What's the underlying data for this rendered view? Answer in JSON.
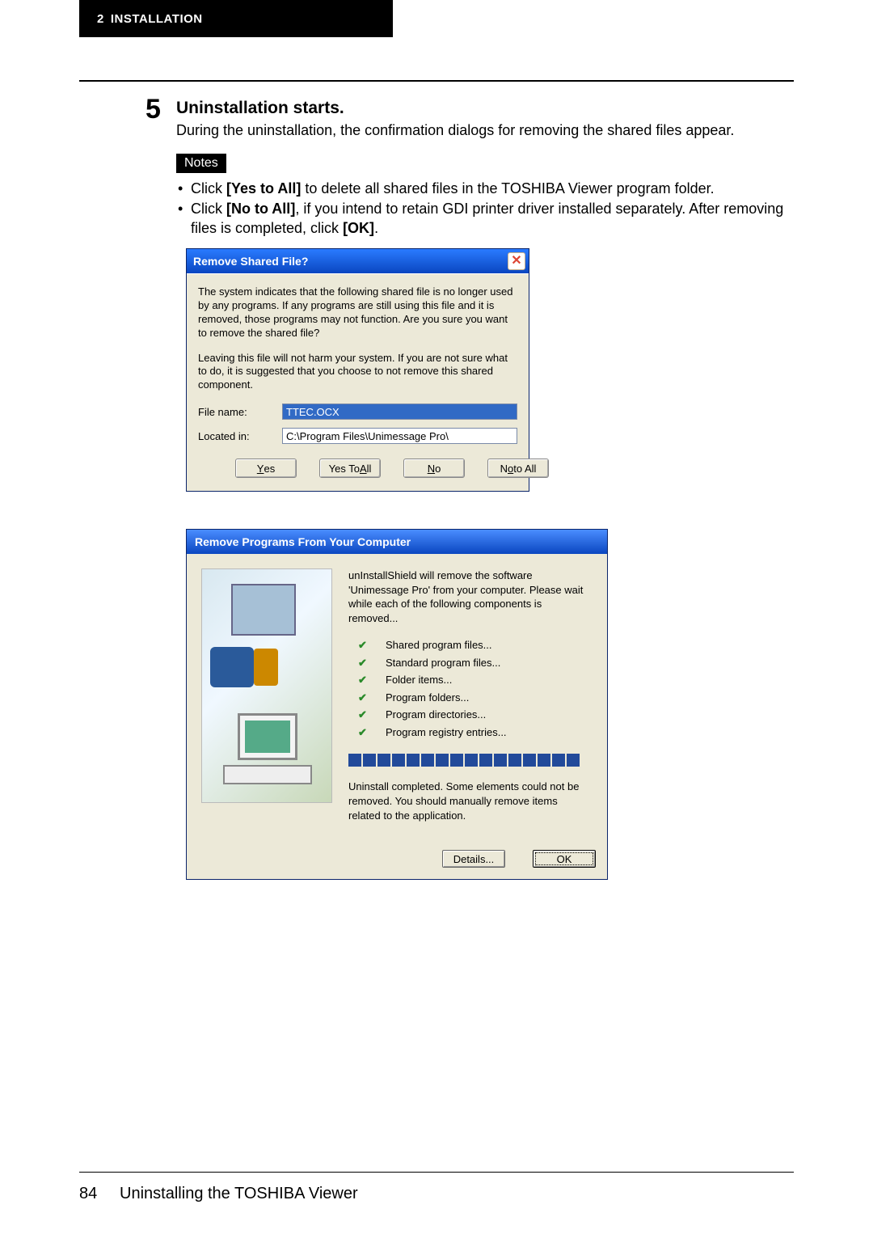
{
  "header": {
    "chapter_num": "2",
    "chapter_title": "INSTALLATION"
  },
  "step": {
    "number": "5",
    "title": "Uninstallation starts.",
    "description": "During the uninstallation, the confirmation dialogs for removing the shared files appear."
  },
  "notes": {
    "label": "Notes",
    "items": [
      {
        "pre": "Click ",
        "bold": "[Yes to All]",
        "post": " to delete all shared files in the TOSHIBA Viewer program folder."
      },
      {
        "pre": "Click ",
        "bold": "[No to All]",
        "post": ", if you intend to retain GDI printer driver installed separately. After removing files is completed, click ",
        "bold2": "[OK]",
        "post2": "."
      }
    ]
  },
  "dialog1": {
    "title": "Remove Shared File?",
    "msg1": "The system indicates that the following shared file is no longer used by any programs.  If any programs are still using this file and it is removed, those programs may not function.  Are you sure you want to remove the shared file?",
    "msg2": "Leaving this file will not harm your system.  If you are not sure what to do, it is suggested that you choose to not remove this shared component.",
    "filename_label": "File name:",
    "filename_value": "TTEC.OCX",
    "located_label": "Located in:",
    "located_value": "C:\\Program Files\\Unimessage Pro\\",
    "buttons": {
      "yes": {
        "u": "Y",
        "rest": "es"
      },
      "yes_all": {
        "pre": "Yes To ",
        "u": "A",
        "post": "ll"
      },
      "no": {
        "u": "N",
        "rest": "o"
      },
      "no_all": {
        "pre": "N",
        "u": "o",
        "post": " to All"
      }
    }
  },
  "dialog2": {
    "title": "Remove Programs From Your Computer",
    "intro": "unInstallShield will remove the software 'Unimessage Pro' from your computer.  Please wait while each of the following components is removed...",
    "items": [
      "Shared program files...",
      "Standard program files...",
      "Folder items...",
      "Program folders...",
      "Program directories...",
      "Program registry entries..."
    ],
    "status": "Uninstall completed.  Some elements could not be removed.  You should manually remove items related to the application.",
    "details_btn": "Details...",
    "ok_btn": "OK"
  },
  "footer": {
    "page": "84",
    "title": "Uninstalling the TOSHIBA Viewer"
  }
}
